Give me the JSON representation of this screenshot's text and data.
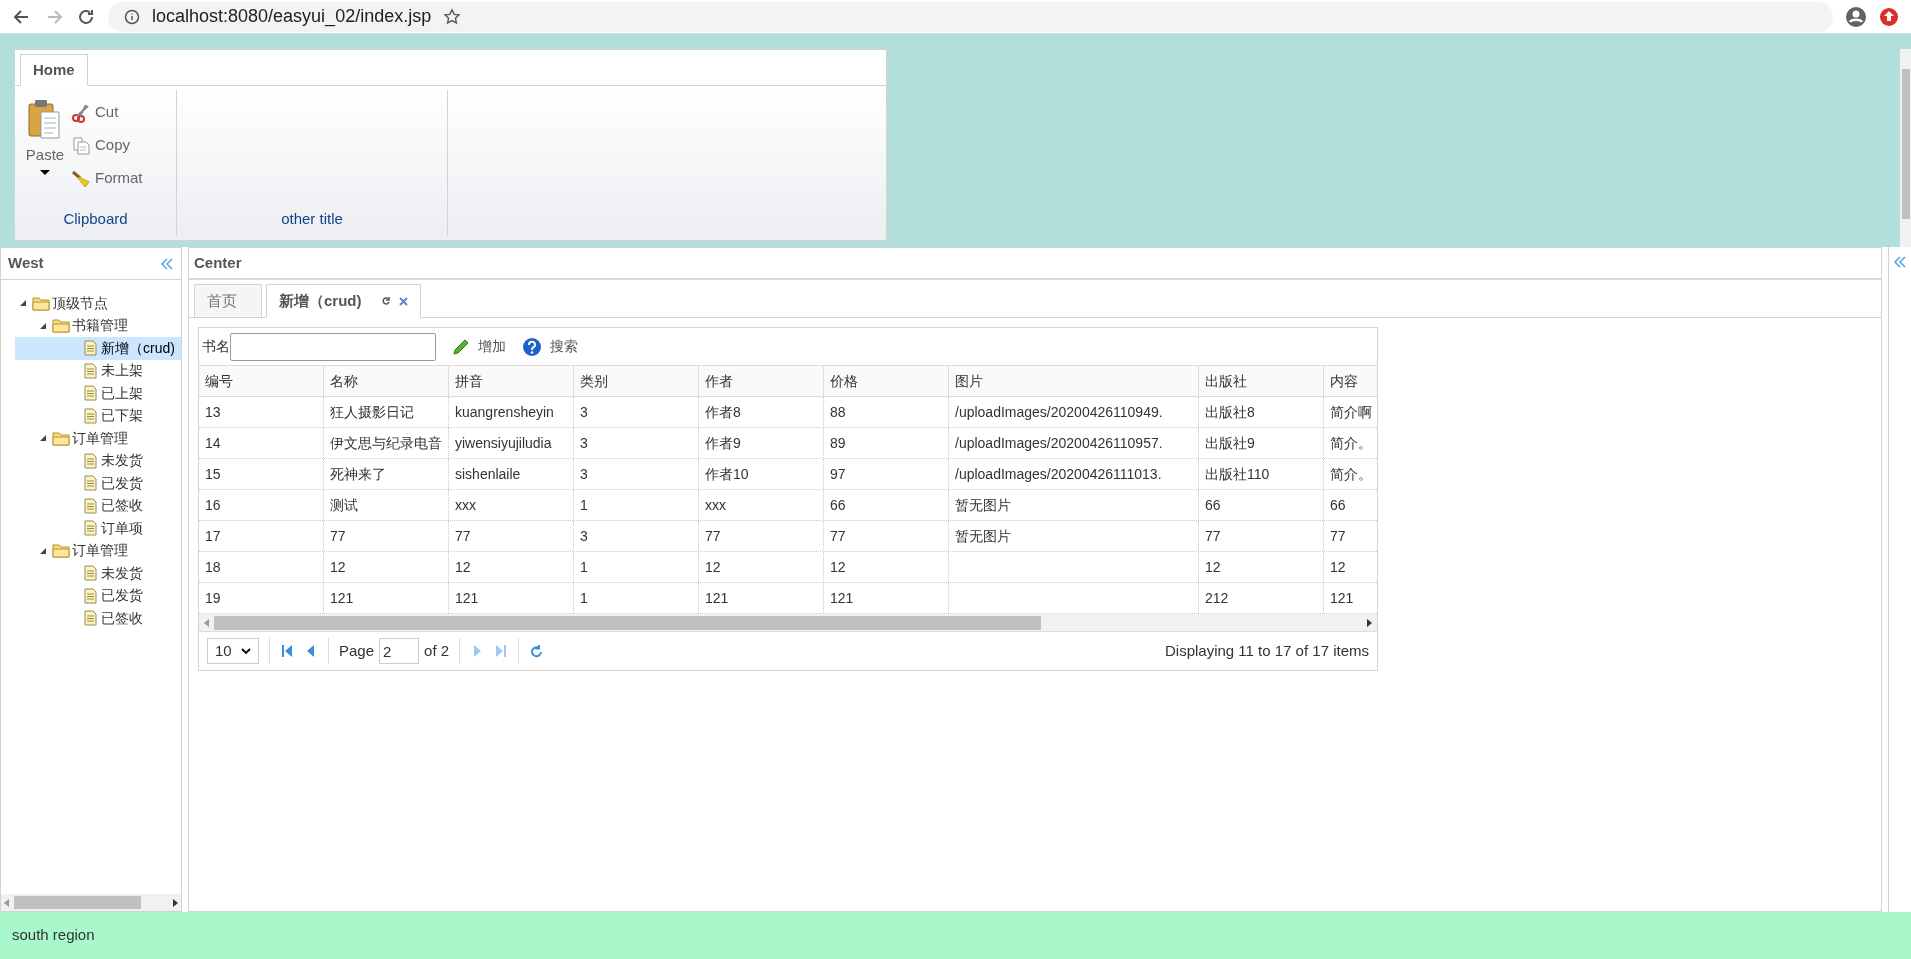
{
  "browser": {
    "url": "localhost:8080/easyui_02/index.jsp"
  },
  "ribbon": {
    "tabs": [
      {
        "label": "Home",
        "selected": true
      }
    ],
    "groups": [
      {
        "title": "Clipboard",
        "buttons": [
          {
            "label": "Paste",
            "kind": "large"
          },
          {
            "label": "Cut",
            "kind": "small"
          },
          {
            "label": "Copy",
            "kind": "small"
          },
          {
            "label": "Format",
            "kind": "small"
          }
        ]
      },
      {
        "title": "other title"
      }
    ]
  },
  "west": {
    "title": "West",
    "tree": [
      {
        "label": "顶级节点",
        "selected": false,
        "expanded": true,
        "children": [
          {
            "label": "书籍管理",
            "selected": false,
            "expanded": true,
            "children": [
              {
                "label": "新增（crud)",
                "selected": true
              },
              {
                "label": "未上架",
                "selected": false
              },
              {
                "label": "已上架",
                "selected": false
              },
              {
                "label": "已下架",
                "selected": false
              }
            ]
          },
          {
            "label": "订单管理",
            "selected": false,
            "expanded": true,
            "children": [
              {
                "label": "未发货",
                "selected": false
              },
              {
                "label": "已发货",
                "selected": false
              },
              {
                "label": "已签收",
                "selected": false
              },
              {
                "label": "订单项",
                "selected": false
              }
            ]
          },
          {
            "label": "订单管理",
            "selected": false,
            "expanded": true,
            "children": [
              {
                "label": "未发货",
                "selected": false
              },
              {
                "label": "已发货",
                "selected": false
              },
              {
                "label": "已签收",
                "selected": false
              }
            ]
          }
        ]
      }
    ]
  },
  "center": {
    "title": "Center",
    "tabs": [
      {
        "label": "首页",
        "selected": false,
        "closable": false
      },
      {
        "label": "新增（crud)",
        "selected": true,
        "closable": true
      }
    ],
    "grid": {
      "toolbar": {
        "label": "书名",
        "buttons": [
          {
            "label": "增加",
            "kind": "add"
          },
          {
            "label": "搜索",
            "kind": "help"
          }
        ]
      },
      "columns": [
        "编号",
        "名称",
        "拼音",
        "类别",
        "作者",
        "价格",
        "图片",
        "出版社",
        "内容"
      ],
      "rows": [
        [
          "13",
          "狂人摄影日记",
          "kuangrensheyin",
          "3",
          "作者8",
          "88",
          "/uploadImages/20200426110949.",
          "出版社8",
          "简介啊"
        ],
        [
          "14",
          "伊文思与纪录电音",
          "yiwensiyujiludia",
          "3",
          "作者9",
          "89",
          "/uploadImages/20200426110957.",
          "出版社9",
          "简介。"
        ],
        [
          "15",
          "死神来了",
          "sishenlaile",
          "3",
          "作者10",
          "97",
          "/uploadImages/20200426111013.",
          "出版社110",
          "简介。"
        ],
        [
          "16",
          "测试",
          "xxx",
          "1",
          "xxx",
          "66",
          "暂无图片",
          "66",
          "66"
        ],
        [
          "17",
          "77",
          "77",
          "3",
          "77",
          "77",
          "暂无图片",
          "77",
          "77"
        ],
        [
          "18",
          "12",
          "12",
          "1",
          "12",
          "12",
          "",
          "12",
          "12"
        ],
        [
          "19",
          "121",
          "121",
          "1",
          "121",
          "121",
          "",
          "212",
          "121"
        ]
      ],
      "pager": {
        "page_size": "10",
        "page_label": "Page",
        "page": "2",
        "of": "of 2",
        "info": "Displaying 11 to 17 of 17 items"
      }
    }
  },
  "south": {
    "text": "south region"
  }
}
